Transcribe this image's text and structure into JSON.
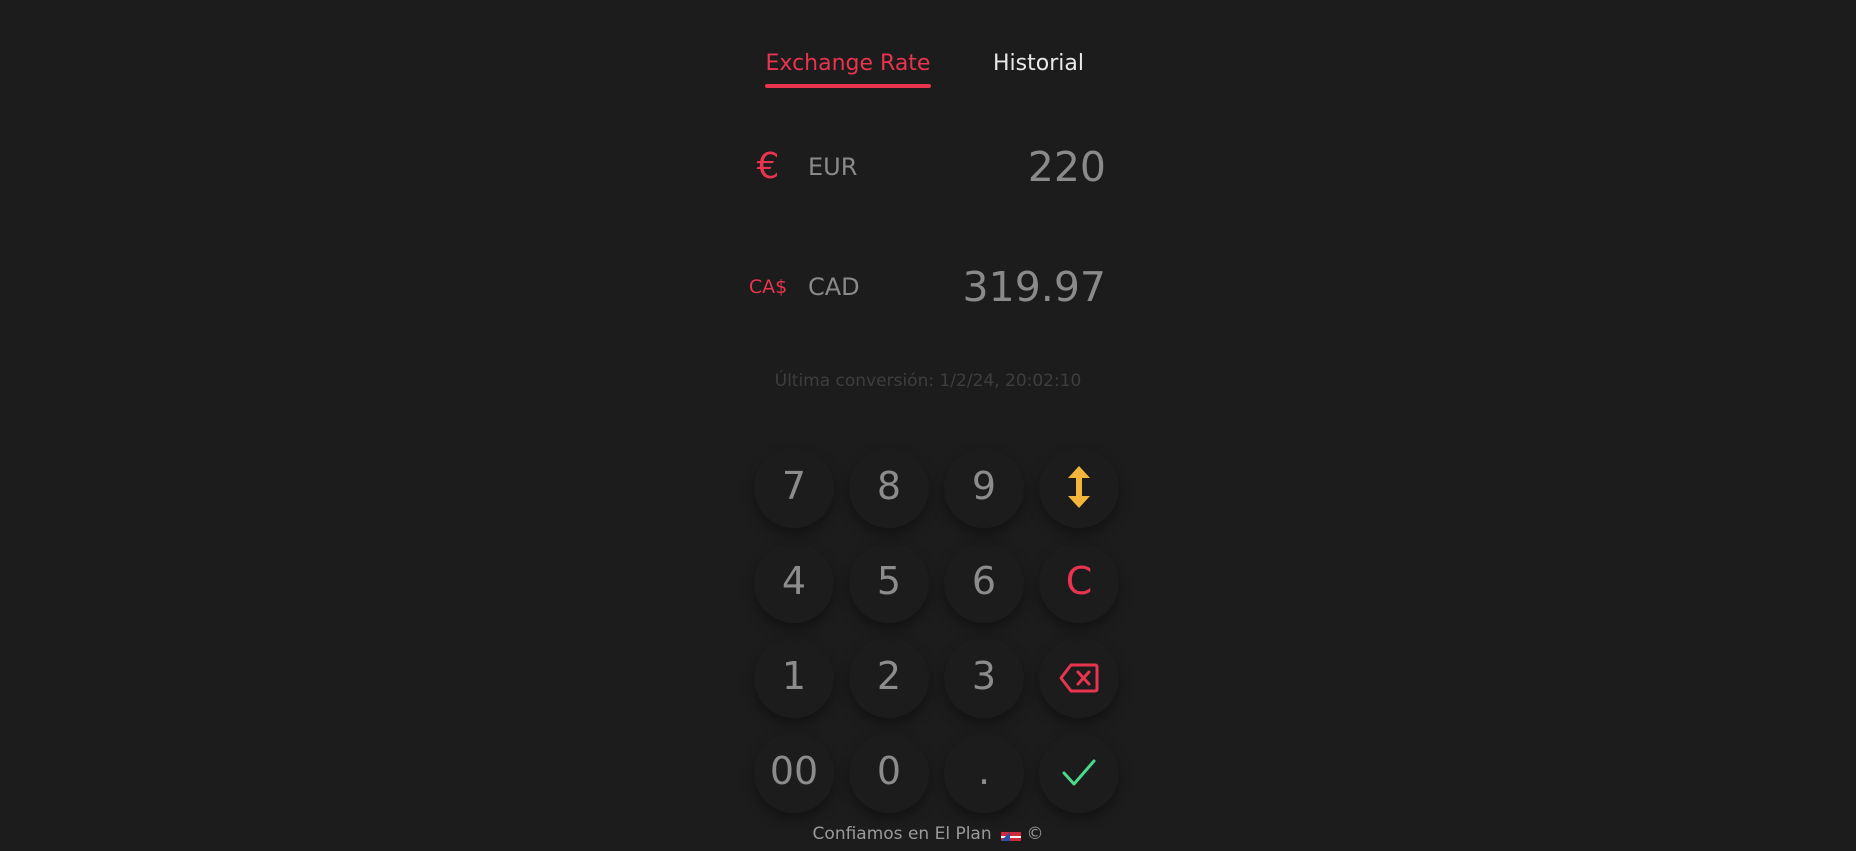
{
  "tabs": {
    "exchange": "Exchange Rate",
    "history": "Historial"
  },
  "converter": {
    "from": {
      "symbol": "€",
      "code": "EUR",
      "amount": "220"
    },
    "to": {
      "symbol": "CA$",
      "code": "CAD",
      "amount": "319.97"
    }
  },
  "last_conversion": "Última conversión: 1/2/24, 20:02:10",
  "keypad": {
    "k7": "7",
    "k8": "8",
    "k9": "9",
    "k4": "4",
    "k5": "5",
    "k6": "6",
    "k1": "1",
    "k2": "2",
    "k3": "3",
    "k00": "00",
    "k0": "0",
    "kdot": ".",
    "clear": "C",
    "icons": [
      "swap-vertical-icon",
      "backspace-icon",
      "check-icon"
    ]
  },
  "colors": {
    "background": "#1c1c1c",
    "accent": "#e8344e",
    "swap": "#f3b63a",
    "confirm": "#4cd98a",
    "digit": "#8c8c8c"
  },
  "footer": {
    "text": "Confiamos en El Plan",
    "copyright": "©",
    "icon": "flag-icon"
  }
}
